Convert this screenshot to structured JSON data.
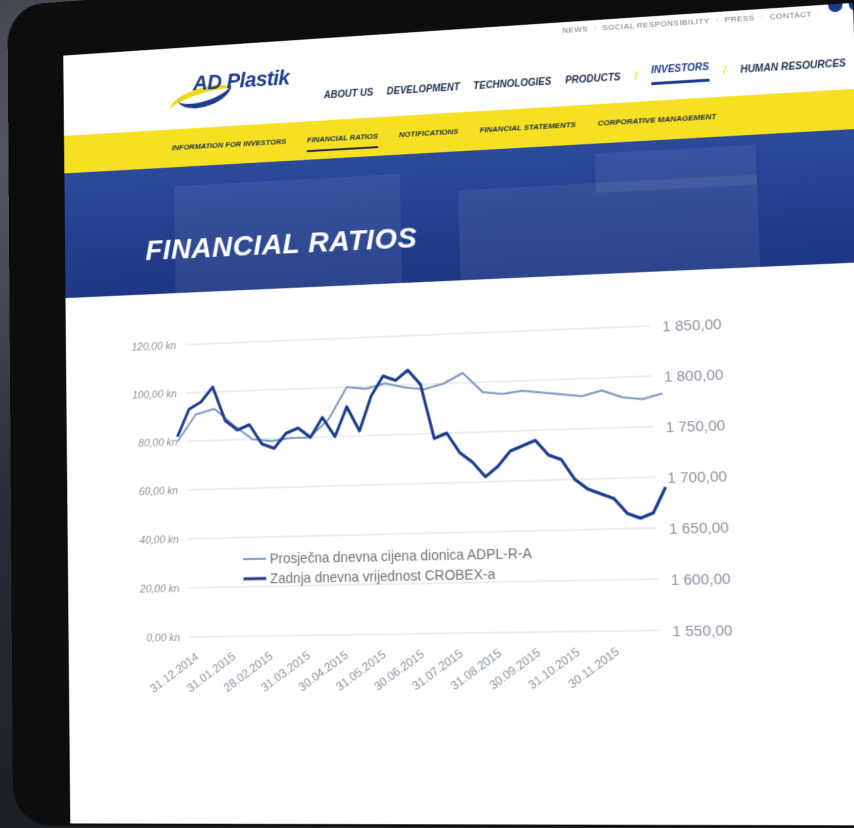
{
  "toplinks": [
    "NEWS",
    "SOCIAL RESPONSIBILITY",
    "PRESS",
    "CONTACT"
  ],
  "logo": {
    "name": "AD Plastik"
  },
  "nav": [
    {
      "label": "ABOUT US"
    },
    {
      "label": "DEVELOPMENT"
    },
    {
      "label": "TECHNOLOGIES"
    },
    {
      "label": "PRODUCTS"
    },
    {
      "label": "INVESTORS",
      "active": true
    },
    {
      "label": "HUMAN RESOURCES"
    }
  ],
  "subnav": [
    {
      "label": "INFORMATION FOR INVESTORS"
    },
    {
      "label": "FINANCIAL RATIOS",
      "active": true
    },
    {
      "label": "NOTIFICATIONS"
    },
    {
      "label": "FINANCIAL STATEMENTS"
    },
    {
      "label": "CORPORATIVE MANAGEMENT"
    }
  ],
  "banner": {
    "title": "FINANCIAL RATIOS"
  },
  "colors": {
    "navy": "#1d3b8f",
    "yellow": "#f5e024",
    "light_series": "#7f97c6",
    "dark_series": "#1f3b8c"
  },
  "chart_data": {
    "type": "line",
    "x": [
      "31.12.2014",
      "31.01.2015",
      "28.02.2015",
      "31.03.2015",
      "30.04.2015",
      "31.05.2015",
      "30.06.2015",
      "31.07.2015",
      "31.08.2015",
      "30.09.2015",
      "31.10.2015",
      "30.11.2015"
    ],
    "left_axis": {
      "ticks": [
        "0,00 kn",
        "20,00 kn",
        "40,00 kn",
        "60,00 kn",
        "80,00 kn",
        "100,00 kn",
        "120,00 kn"
      ],
      "ylim": [
        0,
        120
      ]
    },
    "right_axis": {
      "ticks": [
        "1 550,00",
        "1 600,00",
        "1 650,00",
        "1 700,00",
        "1 750,00",
        "1 800,00",
        "1 850,00"
      ],
      "ylim": [
        1550,
        1850
      ]
    },
    "series": [
      {
        "name": "Prosječna dnevna cijena dionica ADPL-R-A",
        "axis": "left",
        "values": [
          80,
          91,
          93,
          86,
          80,
          79,
          80,
          80,
          87,
          100,
          99,
          101,
          99,
          98,
          100,
          104,
          96,
          95,
          96,
          95,
          94,
          93,
          95,
          92,
          91,
          93
        ]
      },
      {
        "name": "Zadnja dnevna vrijednost CROBEX-a",
        "axis": "right",
        "values": [
          1755,
          1783,
          1790,
          1805,
          1770,
          1760,
          1765,
          1745,
          1740,
          1755,
          1760,
          1750,
          1770,
          1750,
          1780,
          1755,
          1790,
          1810,
          1805,
          1815,
          1800,
          1745,
          1750,
          1730,
          1720,
          1705,
          1715,
          1730,
          1735,
          1740,
          1725,
          1720,
          1700,
          1690,
          1685,
          1680,
          1665,
          1660,
          1665,
          1690
        ]
      }
    ],
    "legend": "bottom-left inside"
  }
}
